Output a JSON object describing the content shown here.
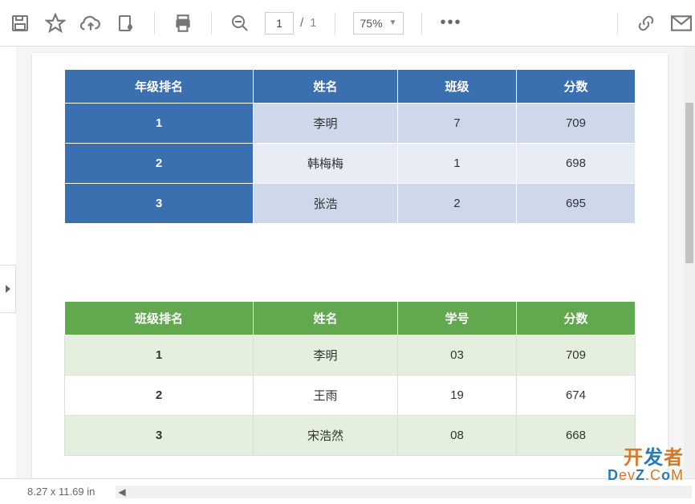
{
  "toolbar": {
    "page_current": "1",
    "page_sep": "/",
    "page_total": "1",
    "zoom": "75%"
  },
  "status": {
    "dimensions": "8.27 x 11.69 in"
  },
  "table1": {
    "headers": [
      "年级排名",
      "姓名",
      "班级",
      "分数"
    ],
    "rows": [
      [
        "1",
        "李明",
        "7",
        "709"
      ],
      [
        "2",
        "韩梅梅",
        "1",
        "698"
      ],
      [
        "3",
        "张浩",
        "2",
        "695"
      ]
    ]
  },
  "table2": {
    "headers": [
      "班级排名",
      "姓名",
      "学号",
      "分数"
    ],
    "rows": [
      [
        "1",
        "李明",
        "03",
        "709"
      ],
      [
        "2",
        "王雨",
        "19",
        "674"
      ],
      [
        "3",
        "宋浩然",
        "08",
        "668"
      ]
    ]
  },
  "watermark": {
    "line1a": "开",
    "line1b": "发",
    "line1c": "者",
    "line2a": "D",
    "line2b": "ev",
    "line2c": "Z",
    "line2d": ".C",
    "line2e": "o",
    "line2f": "M"
  }
}
